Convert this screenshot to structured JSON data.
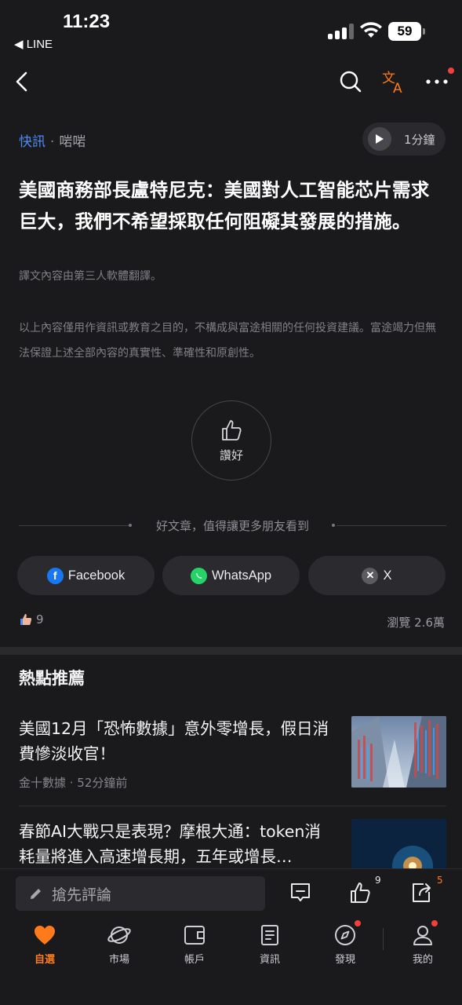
{
  "status_bar": {
    "time": "11:23",
    "back_app": "◀ LINE",
    "battery": "59"
  },
  "meta": {
    "category": "快訊",
    "separator": "·",
    "source": "啱啱",
    "audio_label": "1分鐘"
  },
  "headline": "美國商務部長盧特尼克：美國對人工智能芯片需求巨大，我們不希望採取任何阻礙其發展的措施。",
  "translation_note": "譯文內容由第三人軟體翻譯。",
  "disclaimer": "以上內容僅用作資訊或教育之目的，不構成與富途相關的任何投資建議。富途竭力但無法保證上述全部內容的真實性、準確性和原創性。",
  "like_button": {
    "label": "讚好"
  },
  "share_prompt": "好文章，值得讓更多朋友看到",
  "share": {
    "facebook": "Facebook",
    "whatsapp": "WhatsApp",
    "x": "X"
  },
  "stats": {
    "likes": "9",
    "views": "瀏覽  2.6萬"
  },
  "recommend": {
    "title": "熱點推薦",
    "items": [
      {
        "title": "美國12月「恐怖數據」意外零增長，假日消費慘淡收官！",
        "source": "金十數據 · 52分鐘前"
      },
      {
        "title": "春節AI大戰只是表現？摩根大通：token消耗量將進入高速增長期，五年或增長…",
        "source": ""
      }
    ]
  },
  "comment_bar": {
    "placeholder": "搶先評論",
    "like_count": "9",
    "share_count": "5"
  },
  "tabs": [
    {
      "label": "自選",
      "icon": "heart-icon",
      "active": true
    },
    {
      "label": "市場",
      "icon": "planet-icon"
    },
    {
      "label": "帳戶",
      "icon": "wallet-icon"
    },
    {
      "label": "資訊",
      "icon": "news-icon"
    },
    {
      "label": "發現",
      "icon": "compass-icon"
    },
    {
      "label": "我的",
      "icon": "person-icon"
    }
  ],
  "colors": {
    "accent": "#ff7a1a",
    "link": "#4e8bf5",
    "badge": "#f2413d",
    "background": "#1a1a1c"
  }
}
